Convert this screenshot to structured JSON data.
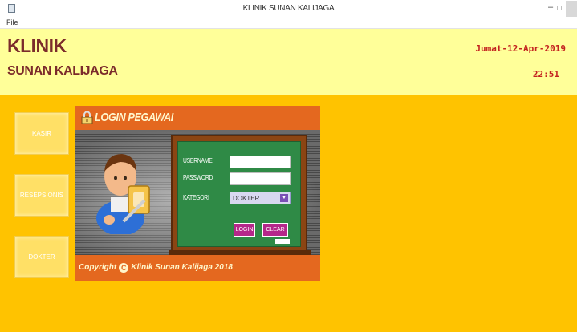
{
  "window": {
    "title": "KLINIK SUNAN KALIJAGA",
    "minimize_glyph": "–",
    "maximize_glyph": "□"
  },
  "menu": {
    "file": "File"
  },
  "header": {
    "line1": "KLINIK",
    "line2": "SUNAN KALIJAGA",
    "date": "Jumat-12-Apr-2019",
    "time": "22:51"
  },
  "sidebar": {
    "kasir": "KASIR",
    "resepsionis": "RESEPSIONIS",
    "dokter": "DOKTER"
  },
  "login": {
    "heading": "LOGIN PEGAWAI",
    "username_label": "USERNAME",
    "password_label": "PASSWORD",
    "kategori_label": "KATEGORI",
    "username_value": "",
    "password_value": "",
    "kategori_value": "DOKTER",
    "dropdown_arrow": "▼",
    "login_button": "LOGIN",
    "clear_button": "CLEAR",
    "copyright_prefix": "Copyright",
    "copyright_symbol": "C",
    "copyright_text": "Klinik Sunan Kalijaga 2018"
  },
  "colors": {
    "background": "#ffc300",
    "header_bg": "#ffff99",
    "header_text": "#7b2b2b",
    "clock_text": "#c3221f",
    "panel_orange": "#e4681f",
    "board_green": "#2f8a46",
    "button_magenta": "#b5288a"
  }
}
